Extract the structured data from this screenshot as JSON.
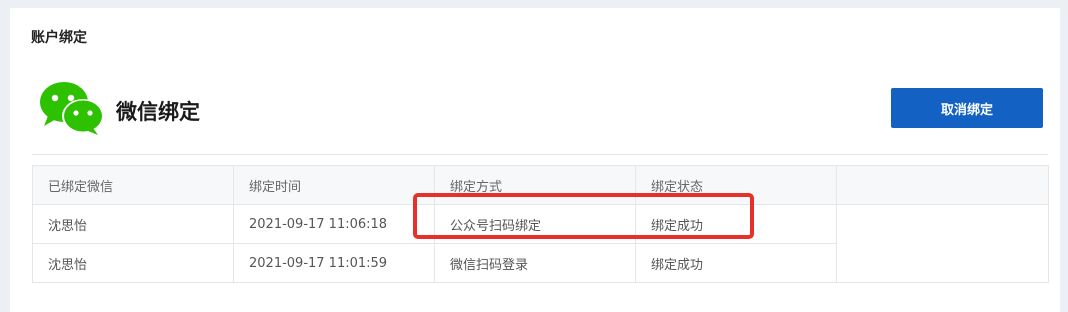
{
  "section": {
    "title": "账户绑定"
  },
  "wechat": {
    "icon": "wechat-logo-icon",
    "brand_color": "#2dc100",
    "title": "微信绑定",
    "unbind_label": "取消绑定",
    "button_color": "#1361c3"
  },
  "table": {
    "headers": [
      "已绑定微信",
      "绑定时间",
      "绑定方式",
      "绑定状态"
    ],
    "rows": [
      {
        "account": "沈思怡",
        "time": "2021-09-17 11:06:18",
        "method": "公众号扫码绑定",
        "status": "绑定成功"
      },
      {
        "account": "沈思怡",
        "time": "2021-09-17 11:01:59",
        "method": "微信扫码登录",
        "status": "绑定成功"
      }
    ]
  },
  "annotation": {
    "color": "#e8302b"
  }
}
